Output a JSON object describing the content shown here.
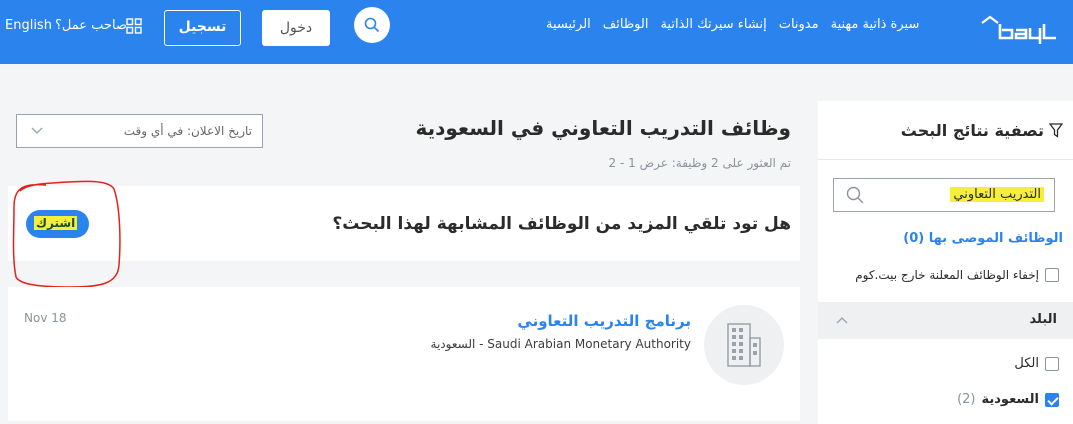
{
  "header": {
    "language": "English",
    "employer": "صاحب عمل؟",
    "register": "تسجيل",
    "login": "دخول",
    "nav": [
      "الرئيسية",
      "الوظائف",
      "إنشاء سيرتك الذاتية",
      "مدونات",
      "سيرة ذاتية مهنية"
    ],
    "brand_color": "#2b83ee"
  },
  "sidebar": {
    "filter_title": "تصفية نتائج البحث",
    "keyword": "التدريب التعاوني",
    "recommended": "الوظائف الموصى بها (0)",
    "hide_external": "إخفاء الوظائف المعلنة خارج بيت.كوم",
    "country_title": "البلد",
    "all": "الكل",
    "country_name": "السعودية",
    "country_count": "(2)"
  },
  "main": {
    "title": "وظائف التدريب التعاوني في السعودية",
    "count": "تم العثور على 2 وظيفة: عرض 1 - 2",
    "date_filter": "تاريخ الاعلان: في أي وقت",
    "alert_question": "هل تود تلقي المزيد من الوظائف المشابهة لهذا البحث؟",
    "subscribe": "اشترك"
  },
  "jobs": [
    {
      "title": "برنامج التدريب التعاوني",
      "company": "Saudi Arabian Monetary Authority - السعودية",
      "date": "Nov 18"
    }
  ]
}
